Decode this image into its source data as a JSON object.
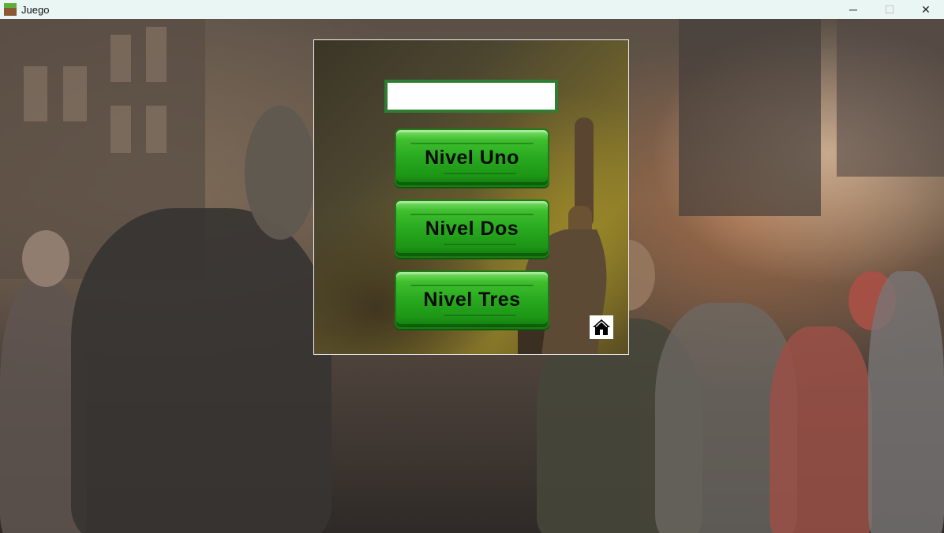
{
  "window": {
    "title": "Juego",
    "icon": "grass-block-icon",
    "controls": {
      "minimize": "─",
      "maximize": "☐",
      "close": "✕"
    }
  },
  "menu": {
    "name_input": {
      "value": "",
      "placeholder": ""
    },
    "levels": [
      {
        "label": "Nivel Uno"
      },
      {
        "label": "Nivel Dos"
      },
      {
        "label": "Nivel Tres"
      }
    ],
    "home_icon": "home-icon"
  },
  "colors": {
    "button_green": "#28a91f",
    "input_border": "#2e7d32",
    "button_text": "#0a0a0a"
  }
}
